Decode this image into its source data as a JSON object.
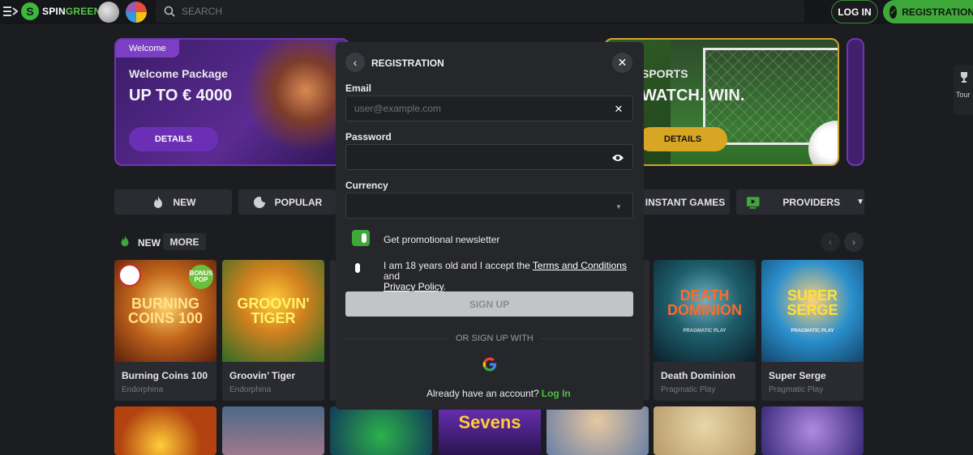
{
  "header": {
    "brand_prefix": "SPIN",
    "brand_suffix": "GREEN",
    "search_placeholder": "SEARCH",
    "login_label": "LOG IN",
    "registration_label": "REGISTRATION"
  },
  "banners": [
    {
      "badge": "Welcome",
      "title": "Welcome Package",
      "big": "UP TO € 4000",
      "button": "DETAILS"
    },
    {
      "title": "SPORTS",
      "big": "WATCH. WIN.",
      "button": "DETAILS"
    }
  ],
  "side_tab": {
    "label": "Tour"
  },
  "categories": [
    {
      "label": "NEW",
      "icon": "flame-icon"
    },
    {
      "label": "POPULAR",
      "icon": "flame-swirl-icon"
    },
    {
      "label": "INSTANT GAMES"
    },
    {
      "label": "PROVIDERS",
      "icon": "play-icon"
    }
  ],
  "section": {
    "title": "NEW",
    "more": "MORE"
  },
  "games": [
    {
      "name": "Burning Coins 100",
      "provider": "Endorphina",
      "art": "BURNING COINS 100",
      "color": "#c2661c"
    },
    {
      "name": "Groovin’ Tiger",
      "provider": "Endorphina",
      "art": "GROOVIN' TIGER",
      "color": "#d1811f"
    },
    {
      "name": "Death Dominion",
      "provider": "Pragmatic Play",
      "art": "DEATH DOMINION",
      "color": "#1d5d6a"
    },
    {
      "name": "Super Serge",
      "provider": "Pragmatic Play",
      "art": "SUPER SERGE",
      "color": "#2a8fcc"
    }
  ],
  "game_badges": {
    "bonus_pop": "BONUS POP",
    "pragmatic_play": "PRAGMATIC PLAY",
    "sevens": "Sevens"
  },
  "modal": {
    "title": "REGISTRATION",
    "email_label": "Email",
    "email_placeholder": "user@example.com",
    "password_label": "Password",
    "currency_label": "Currency",
    "newsletter_label": "Get promotional newsletter",
    "newsletter_on": true,
    "terms_prefix": "I am 18 years old and I accept the ",
    "terms_link": "Terms and Conditions",
    "terms_and": " and",
    "privacy_link": "Privacy Policy",
    "terms_suffix": ".",
    "terms_on": false,
    "signup_label": "SIGN UP",
    "or_label": "OR SIGN UP WITH",
    "have_account": "Already have an account?",
    "login_link": "Log In"
  },
  "colors": {
    "accent": "#3fa83b",
    "purple": "#7c3fc4",
    "gold": "#d6a624",
    "background": "#1c1d21"
  }
}
